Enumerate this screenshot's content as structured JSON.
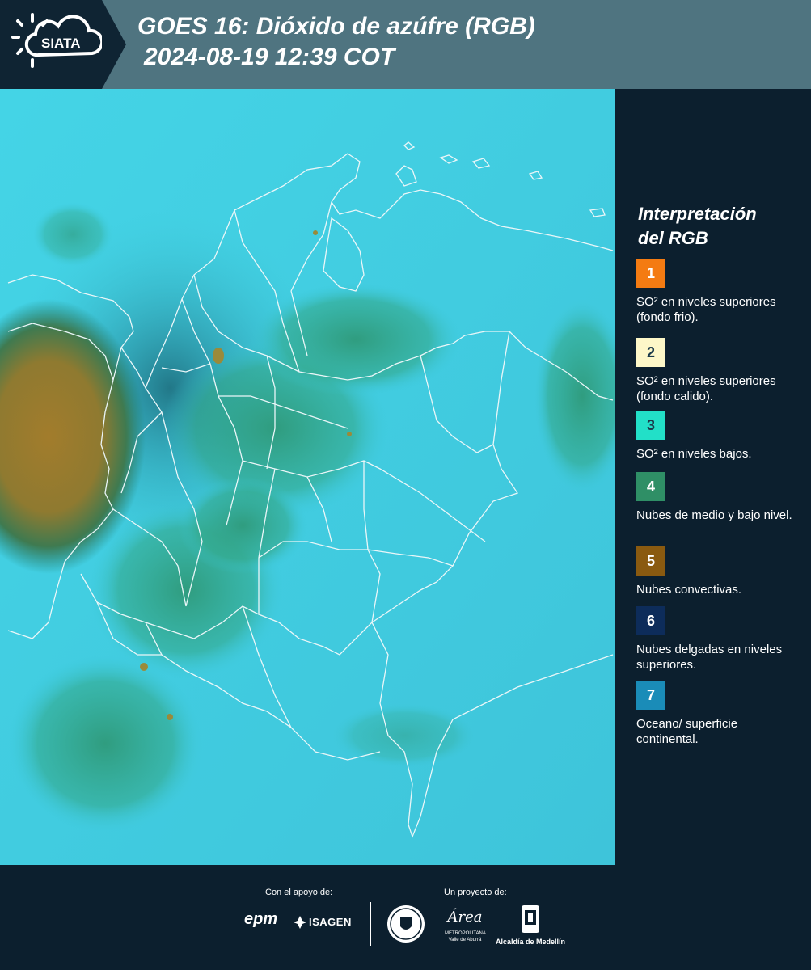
{
  "header": {
    "logo_text": "SIATA",
    "title_line1": "GOES 16: Dióxido de azúfre (RGB)",
    "title_line2": "2024-08-19 12:39 COT"
  },
  "map": {
    "description_colors": {
      "ocean_land": "#3fd0e0",
      "low_clouds": "#2f9a7a",
      "convective": "#8f7a30",
      "borders": "#e8f4f6"
    }
  },
  "legend": {
    "title_line1": "Interpretación",
    "title_line2": "del RGB",
    "items": [
      {
        "number": "1",
        "color": "#f47b12",
        "text": "SO² en niveles superiores (fondo frio)."
      },
      {
        "number": "2",
        "color": "#fdf7c8",
        "text": "SO² en niveles superiores (fondo calido)."
      },
      {
        "number": "3",
        "color": "#22e0c8",
        "text": "SO² en niveles bajos."
      },
      {
        "number": "4",
        "color": "#2f8f66",
        "text": "Nubes de medio y bajo nivel."
      },
      {
        "number": "5",
        "color": "#8a5a10",
        "text": "Nubes convectivas."
      },
      {
        "number": "6",
        "color": "#0d2c5a",
        "text": "Nubes delgadas en niveles superiores."
      },
      {
        "number": "7",
        "color": "#1a8cb8",
        "text": "Oceano/ superficie continental."
      }
    ]
  },
  "footer": {
    "support_label": "Con el apoyo de:",
    "project_label": "Un proyecto de:",
    "epm": "epm",
    "isagen": "ISAGEN",
    "area_word": "Área",
    "area_sub1": "METROPOLITANA",
    "area_sub2": "Valle de Aburrá",
    "alcaldia": "Alcaldía de Medellín"
  }
}
